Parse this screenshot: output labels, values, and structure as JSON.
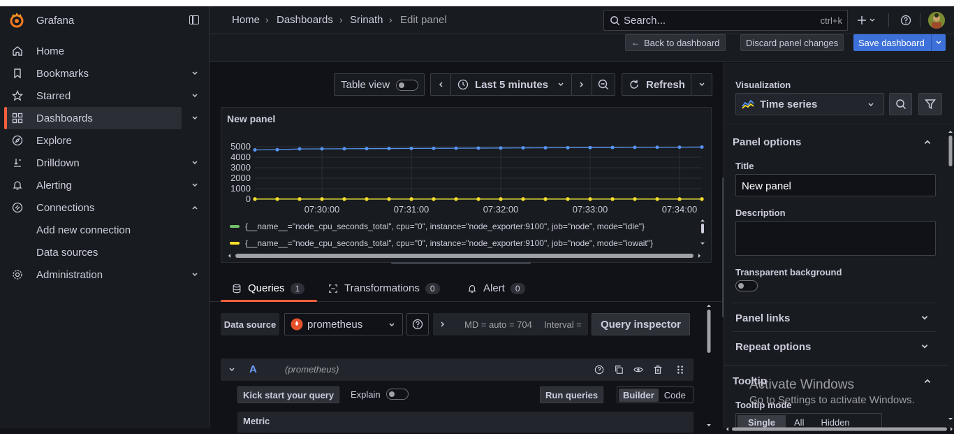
{
  "app": {
    "name": "Grafana"
  },
  "colors": {
    "accent": "#f55f3e",
    "primary": "#3d71d9",
    "series_idle": "#73bf69",
    "series_iowait": "#fade2a",
    "series_blue": "#5794f2"
  },
  "sidebar": {
    "items": [
      {
        "label": "Home",
        "icon": "home-icon"
      },
      {
        "label": "Bookmarks",
        "icon": "bookmark-icon"
      },
      {
        "label": "Starred",
        "icon": "star-icon"
      },
      {
        "label": "Dashboards",
        "icon": "apps-icon"
      },
      {
        "label": "Explore",
        "icon": "compass-icon"
      },
      {
        "label": "Drilldown",
        "icon": "drilldown-icon"
      },
      {
        "label": "Alerting",
        "icon": "bell-icon"
      },
      {
        "label": "Connections",
        "icon": "connections-icon"
      },
      {
        "label": "Administration",
        "icon": "cog-icon"
      }
    ],
    "sub_items": [
      "Add new connection",
      "Data sources"
    ]
  },
  "header": {
    "breadcrumbs": [
      "Home",
      "Dashboards",
      "Srinath",
      "Edit panel"
    ],
    "search_placeholder": "Search...",
    "search_shortcut": "ctrl+k"
  },
  "actions": {
    "back": "Back to dashboard",
    "discard": "Discard panel changes",
    "save": "Save dashboard"
  },
  "toolbar": {
    "table_view": "Table view",
    "time_range": "Last 5 minutes",
    "refresh": "Refresh"
  },
  "panel": {
    "title": "New panel",
    "y_ticks": [
      "5000",
      "4000",
      "3000",
      "2000",
      "1000",
      "0"
    ],
    "x_ticks": [
      "07:30:00",
      "07:31:00",
      "07:32:00",
      "07:33:00",
      "07:34:00"
    ],
    "legend": [
      "{__name__=\"node_cpu_seconds_total\", cpu=\"0\", instance=\"node_exporter:9100\", job=\"node\", mode=\"idle\"}",
      "{__name__=\"node_cpu_seconds_total\", cpu=\"0\", instance=\"node_exporter:9100\", job=\"node\", mode=\"iowait\"}"
    ]
  },
  "chart_data": {
    "type": "line",
    "x": [
      "07:29:15",
      "07:29:30",
      "07:29:45",
      "07:30:00",
      "07:30:15",
      "07:30:30",
      "07:30:45",
      "07:31:00",
      "07:31:15",
      "07:31:30",
      "07:31:45",
      "07:32:00",
      "07:32:15",
      "07:32:30",
      "07:32:45",
      "07:33:00",
      "07:33:15",
      "07:33:30",
      "07:33:45",
      "07:34:00",
      "07:34:15"
    ],
    "series": [
      {
        "values": [
          4700,
          4720,
          4790,
          4800,
          4810,
          4820,
          4830,
          4840,
          4850,
          4860,
          4870,
          4880,
          4890,
          4900,
          4910,
          4920,
          4930,
          4940,
          4950,
          4960,
          4970
        ]
      },
      {
        "values": [
          5,
          5,
          5,
          5,
          5,
          5,
          5,
          5,
          5,
          5,
          5,
          5,
          5,
          5,
          5,
          5,
          5,
          5,
          5,
          5,
          5
        ]
      },
      {
        "values": [
          15,
          15,
          15,
          15,
          15,
          15,
          15,
          15,
          15,
          15,
          15,
          15,
          15,
          15,
          15,
          15,
          15,
          15,
          15,
          15,
          15
        ]
      }
    ],
    "ylim": [
      0,
      5000
    ],
    "grid": true,
    "legend_placement": "bottom"
  },
  "tabs": [
    {
      "label": "Queries",
      "count": "1"
    },
    {
      "label": "Transformations",
      "count": "0"
    },
    {
      "label": "Alert",
      "count": "0"
    }
  ],
  "query": {
    "datasource_label": "Data source",
    "datasource_value": "prometheus",
    "md": "MD = auto = 704",
    "interval": "Interval =",
    "inspector": "Query inspector",
    "ref_id": "A",
    "ref_source": "(prometheus)",
    "kick_start": "Kick start your query",
    "explain": "Explain",
    "run": "Run queries",
    "builder": "Builder",
    "code": "Code",
    "metric": "Metric"
  },
  "options": {
    "visualization_label": "Visualization",
    "visualization_value": "Time series",
    "panel_options": "Panel options",
    "title_label": "Title",
    "title_value": "New panel",
    "description_label": "Description",
    "transparent_label": "Transparent background",
    "panel_links": "Panel links",
    "repeat_options": "Repeat options",
    "tooltip": "Tooltip",
    "tooltip_mode": "Tooltip mode",
    "tooltip_modes": [
      "Single",
      "All",
      "Hidden"
    ]
  },
  "watermark": {
    "line1": "Activate Windows",
    "line2": "Go to Settings to activate Windows."
  }
}
